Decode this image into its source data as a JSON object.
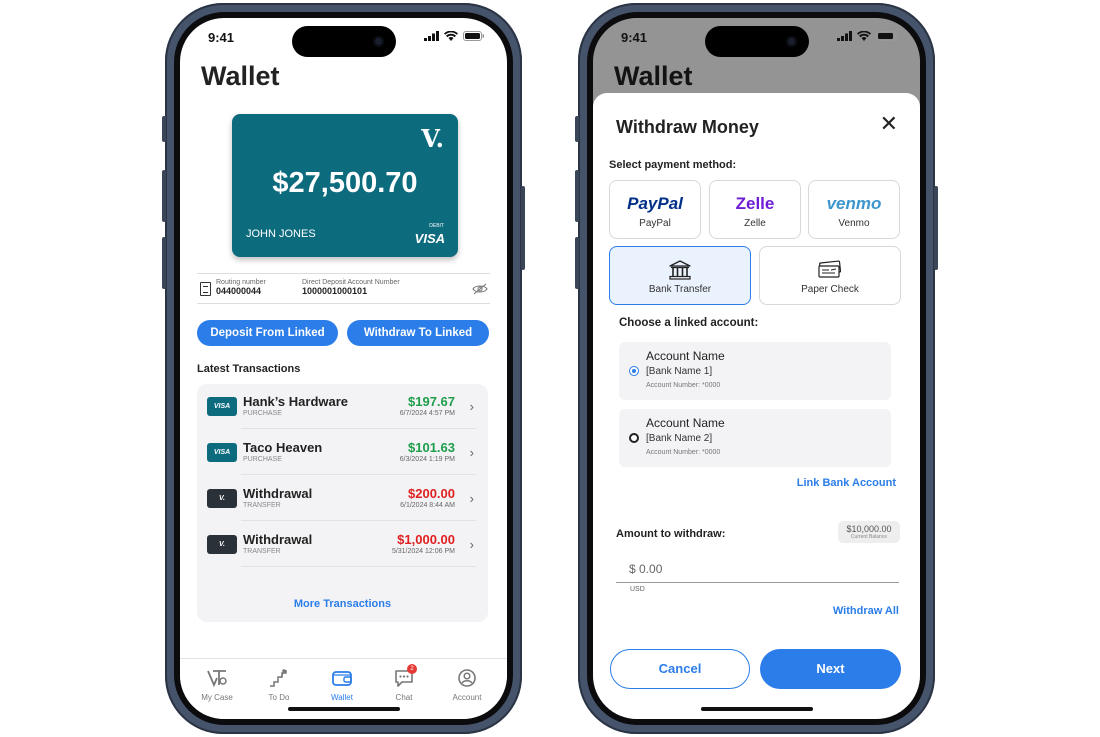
{
  "status": {
    "time": "9:41"
  },
  "wallet": {
    "title": "Wallet",
    "card": {
      "logo": "V.",
      "balance": "$27,500.70",
      "holder": "JOHN JONES",
      "debit_label": "DEBIT",
      "network": "VISA"
    },
    "account": {
      "routing_label": "Routing number",
      "routing_value": "044000044",
      "direct_label": "Direct Deposit Account Number",
      "direct_value": "1000001000101"
    },
    "buttons": {
      "deposit": "Deposit From Linked",
      "withdraw": "Withdraw To Linked"
    },
    "transactions_heading": "Latest Transactions",
    "transactions": [
      {
        "badge": "VISA",
        "badge_color": "#0d6b7e",
        "name": "Hank’s Hardware",
        "type": "PURCHASE",
        "amount": "$197.67",
        "amount_color": "#1e9e4a",
        "date": "6/7/2024 4:57 PM"
      },
      {
        "badge": "VISA",
        "badge_color": "#0d6b7e",
        "name": "Taco Heaven",
        "type": "PURCHASE",
        "amount": "$101.63",
        "amount_color": "#1e9e4a",
        "date": "6/3/2024 1:19 PM"
      },
      {
        "badge": "V.",
        "badge_color": "#2b3138",
        "name": "Withdrawal",
        "type": "TRANSFER",
        "amount": "$200.00",
        "amount_color": "#e02020",
        "date": "6/1/2024 8:44 AM"
      },
      {
        "badge": "V.",
        "badge_color": "#2b3138",
        "name": "Withdrawal",
        "type": "TRANSFER",
        "amount": "$1,000.00",
        "amount_color": "#e02020",
        "date": "5/31/2024 12:06 PM"
      }
    ],
    "more_link": "More Transactions",
    "tabs": [
      {
        "label": "My Case",
        "icon": "my-case-icon"
      },
      {
        "label": "To Do",
        "icon": "to-do-icon"
      },
      {
        "label": "Wallet",
        "icon": "wallet-icon",
        "active": true
      },
      {
        "label": "Chat",
        "icon": "chat-icon",
        "badge": "2"
      },
      {
        "label": "Account",
        "icon": "account-icon"
      }
    ]
  },
  "withdraw": {
    "title": "Withdraw Money",
    "select_label": "Select payment method:",
    "methods": [
      {
        "logo": "PayPal",
        "name": "PayPal",
        "color": "#003087"
      },
      {
        "logo": "Zelle",
        "name": "Zelle",
        "color": "#6d1ed4"
      },
      {
        "logo": "venmo",
        "name": "Venmo",
        "color": "#3d95ce"
      },
      {
        "name": "Bank Transfer",
        "icon": "bank-icon",
        "selected": true
      },
      {
        "name": "Paper Check",
        "icon": "check-icon"
      }
    ],
    "choose_label": "Choose a linked account:",
    "accounts": [
      {
        "title": "Account Name",
        "bank": "[Bank Name 1]",
        "number": "Account Number: *0000",
        "selected": true
      },
      {
        "title": "Account Name",
        "bank": "[Bank Name 2]",
        "number": "Account Number: *0000",
        "selected": false
      }
    ],
    "link_bank": "Link Bank Account",
    "amount_label": "Amount to withdraw:",
    "balance_value": "$10,000.00",
    "balance_label": "Current Balance",
    "amount_placeholder": "$ 0.00",
    "currency": "USD",
    "withdraw_all": "Withdraw All",
    "cancel": "Cancel",
    "next": "Next"
  },
  "colors": {
    "accent": "#2b7de9",
    "card": "#0d6b7e"
  }
}
